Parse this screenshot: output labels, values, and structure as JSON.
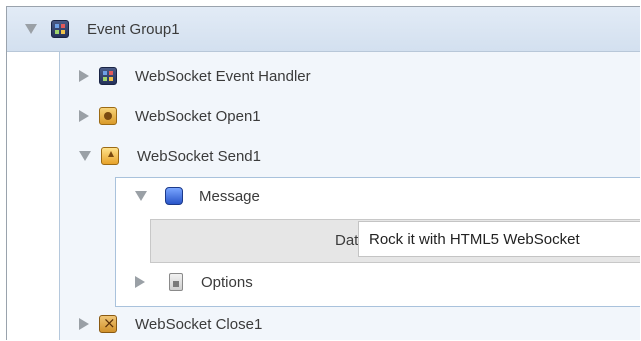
{
  "tree": {
    "group": {
      "label": "Event Group1",
      "icon": "event-group-icon",
      "expanded": true
    },
    "items": [
      {
        "label": "WebSocket Event Handler",
        "icon": "event-handler-icon",
        "expanded": false
      },
      {
        "label": "WebSocket Open1",
        "icon": "open-icon",
        "expanded": false
      },
      {
        "label": "WebSocket Send1",
        "icon": "send-icon",
        "expanded": true
      },
      {
        "label": "WebSocket Close1",
        "icon": "close-icon",
        "expanded": false
      }
    ],
    "send_children": {
      "message": {
        "label": "Message",
        "icon": "message-icon",
        "expanded": true
      },
      "data_field": {
        "label": "Data",
        "value": "Rock it with HTML5 WebSocket"
      },
      "options": {
        "label": "Options",
        "icon": "options-icon",
        "expanded": false
      }
    }
  },
  "colors": {
    "header_bg": "#d9e4f2",
    "group_bg": "#f2f6fb",
    "border": "#a9c2dc"
  }
}
